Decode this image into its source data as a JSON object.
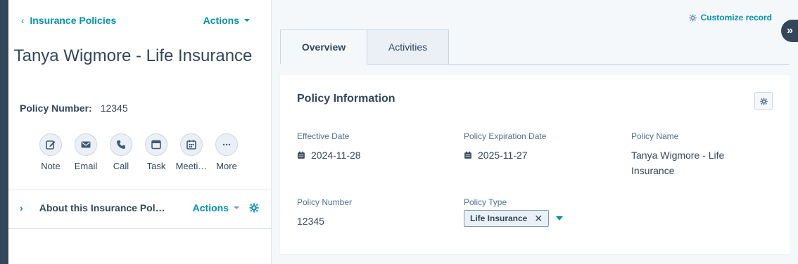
{
  "left": {
    "back_label": "Insurance Policies",
    "actions_label": "Actions",
    "record_title": "Tanya Wigmore - Life Insurance",
    "policy_number_label": "Policy Number:",
    "policy_number_value": "12345",
    "quick_actions": [
      {
        "label": "Note",
        "icon": "note-edit-icon"
      },
      {
        "label": "Email",
        "icon": "email-icon"
      },
      {
        "label": "Call",
        "icon": "phone-icon"
      },
      {
        "label": "Task",
        "icon": "task-icon"
      },
      {
        "label": "Meeti…",
        "icon": "calendar-icon"
      },
      {
        "label": "More",
        "icon": "more-icon"
      }
    ],
    "about_title": "About this Insurance Pol…",
    "about_actions": "Actions"
  },
  "right": {
    "customize_label": "Customize record",
    "tabs": [
      {
        "label": "Overview"
      },
      {
        "label": "Activities"
      }
    ],
    "card": {
      "title": "Policy Information",
      "fields": {
        "effective_date": {
          "label": "Effective Date",
          "value": "2024-11-28"
        },
        "expiration_date": {
          "label": "Policy Expiration Date",
          "value": "2025-11-27"
        },
        "policy_name": {
          "label": "Policy Name",
          "value": "Tanya Wigmore - Life Insurance"
        },
        "policy_number": {
          "label": "Policy Number",
          "value": "12345"
        },
        "policy_type": {
          "label": "Policy Type",
          "value": "Life Insurance"
        }
      }
    }
  },
  "colors": {
    "accent": "#0091ae",
    "text": "#33475b",
    "muted": "#516f90",
    "background": "#f5f8fa",
    "dark_nav": "#33475b"
  }
}
